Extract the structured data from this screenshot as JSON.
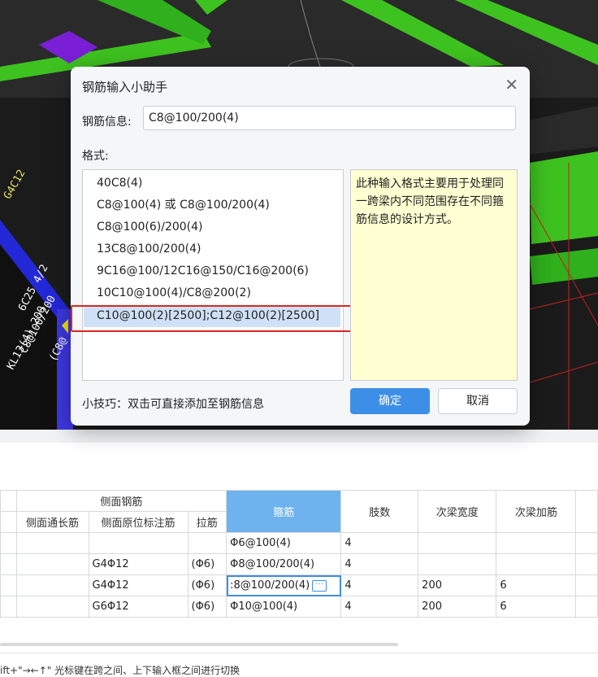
{
  "dialog": {
    "title": "钢筋输入小助手",
    "close_icon": "close-icon",
    "info_label": "钢筋信息:",
    "info_value": "C8@100/200(4)",
    "format_label": "格式:",
    "formats": [
      "40C8(4)",
      "C8@100(4) 或 C8@100/200(4)",
      "C8@100(6)/200(4)",
      "13C8@100/200(4)",
      "9C16@100/12C16@150/C16@200(6)",
      "10C10@100(4)/C8@200(2)",
      "C10@100(2)[2500];C12@100(2)[2500]"
    ],
    "selected_index": 6,
    "description": "此种输入格式主要用于处理同一跨梁内不同范围存在不同箍筋信息的设计方式。",
    "tip": "小技巧：双击可直接添加至钢筋信息",
    "ok_label": "确定",
    "cancel_label": "取消"
  },
  "cad": {
    "labels": [
      "G4C12",
      "KL13(4) 200",
      "C8@100/200",
      "6C25 4/2",
      "(C8@"
    ]
  },
  "table": {
    "group_header": "侧面钢筋",
    "headers": [
      "侧面通长筋",
      "侧面原位标注筋",
      "拉筋",
      "箍筋",
      "肢数",
      "次梁宽度",
      "次梁加筋"
    ],
    "rows": [
      [
        "",
        "",
        "",
        "Φ6@100(4)",
        "4",
        "",
        ""
      ],
      [
        "",
        "G4Φ12",
        "(Φ6)",
        "Φ8@100/200(4)",
        "4",
        "",
        ""
      ],
      [
        "",
        "G4Φ12",
        "(Φ6)",
        ":8@100/200(4)",
        "4",
        "200",
        "6"
      ],
      [
        "",
        "G6Φ12",
        "(Φ6)",
        "Φ10@100(4)",
        "4",
        "200",
        "6"
      ]
    ],
    "active_row": 2
  },
  "status_text": "ift+\"→←↑\" 光标键在跨之间、上下输入框之间进行切换"
}
